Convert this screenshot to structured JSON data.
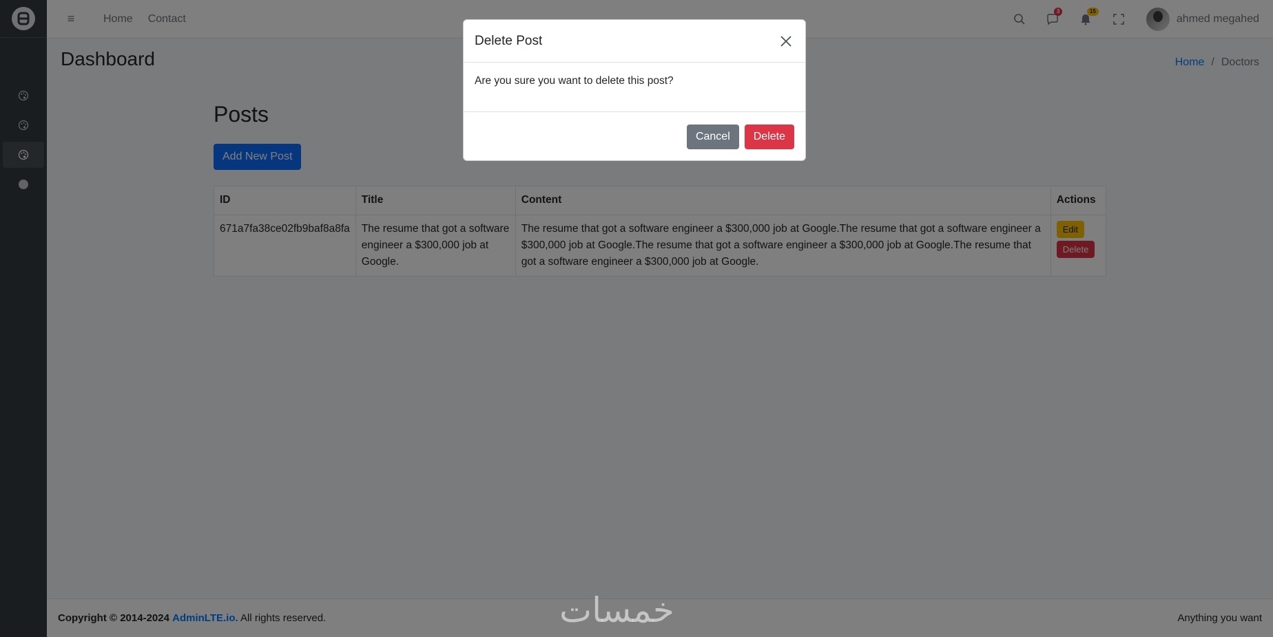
{
  "sidebar": {
    "brand_icon": "adminlte-logo-icon",
    "items": [
      {
        "icon": "palette-icon",
        "active": false
      },
      {
        "icon": "palette-icon",
        "active": false
      },
      {
        "icon": "palette-icon",
        "active": true
      },
      {
        "icon": "circle-icon",
        "active": false
      }
    ]
  },
  "navbar": {
    "toggle_icon": "≡",
    "links": [
      "Home",
      "Contact"
    ],
    "messages_count": "3",
    "notifications_count": "15",
    "user_name": "ahmed megahed"
  },
  "content": {
    "page_title": "Dashboard",
    "breadcrumb": {
      "home": "Home",
      "separator": "/",
      "active": "Doctors"
    },
    "posts_title": "Posts",
    "add_button": "Add New Post",
    "table": {
      "headers": [
        "ID",
        "Title",
        "Content",
        "Actions"
      ],
      "rows": [
        {
          "id": "671a7fa38ce02fb9baf8a8fa",
          "title": "The resume that got a software engineer a $300,000 job at Google.",
          "content": "The resume that got a software engineer a $300,000 job at Google.The resume that got a software engineer a $300,000 job at Google.The resume that got a software engineer a $300,000 job at Google.The resume that got a software engineer a $300,000 job at Google.",
          "edit": "Edit",
          "delete": "Delete"
        }
      ]
    }
  },
  "footer": {
    "copyright": "Copyright © 2014-2024",
    "link": "AdminLTE.io.",
    "rights": "All rights reserved.",
    "right_text": "Anything you want"
  },
  "modal": {
    "title": "Delete Post",
    "body": "Are you sure you want to delete this post?",
    "cancel": "Cancel",
    "confirm": "Delete"
  },
  "watermark": "خمسات",
  "colors": {
    "primary": "#0d6efd",
    "danger": "#dc3545",
    "warning": "#ffc107",
    "secondary": "#6c757d",
    "sidebar": "#343a40"
  }
}
